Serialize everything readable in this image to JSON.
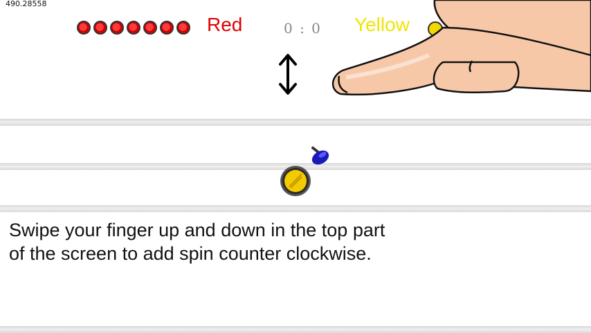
{
  "debug_value": "490.28558",
  "players": {
    "red": {
      "label": "Red",
      "color": "#e00000",
      "pucks_remaining": 7
    },
    "yellow": {
      "label": "Yellow",
      "color": "#f2e400"
    }
  },
  "score_text": "0 : 0",
  "tutorial": {
    "text": "Swipe your finger up and down in the top part of the screen to add spin counter clockwise.",
    "gesture_icon": "swipe-hand-icon",
    "direction_icon": "up-down-arrow-icon"
  }
}
